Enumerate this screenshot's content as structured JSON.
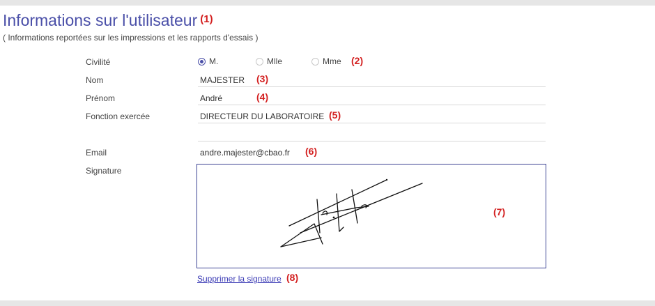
{
  "header": {
    "title": "Informations sur l'utilisateur",
    "title_marker": "(1)",
    "subtitle": "( Informations reportées sur les impressions et les rapports d'essais )"
  },
  "form": {
    "civilite": {
      "label": "Civilité",
      "options": [
        "M.",
        "Mlle",
        "Mme"
      ],
      "selected": "M.",
      "marker": "(2)"
    },
    "nom": {
      "label": "Nom",
      "value": "MAJESTER",
      "marker": "(3)"
    },
    "prenom": {
      "label": "Prénom",
      "value": "André",
      "marker": "(4)"
    },
    "fonction": {
      "label": "Fonction exercée",
      "value": "DIRECTEUR DU LABORATOIRE",
      "marker": "(5)"
    },
    "email": {
      "label": "Email",
      "value": "andre.majester@cbao.fr",
      "marker": "(6)"
    },
    "signature": {
      "label": "Signature",
      "marker": "(7)"
    },
    "delete_signature": {
      "label": "Supprimer la signature",
      "marker": "(8)"
    }
  },
  "colors": {
    "title": "#4a4fa8",
    "annotation": "#d31f1f",
    "link": "#3b3bb5",
    "radio_selected": "#4a4fa8"
  }
}
